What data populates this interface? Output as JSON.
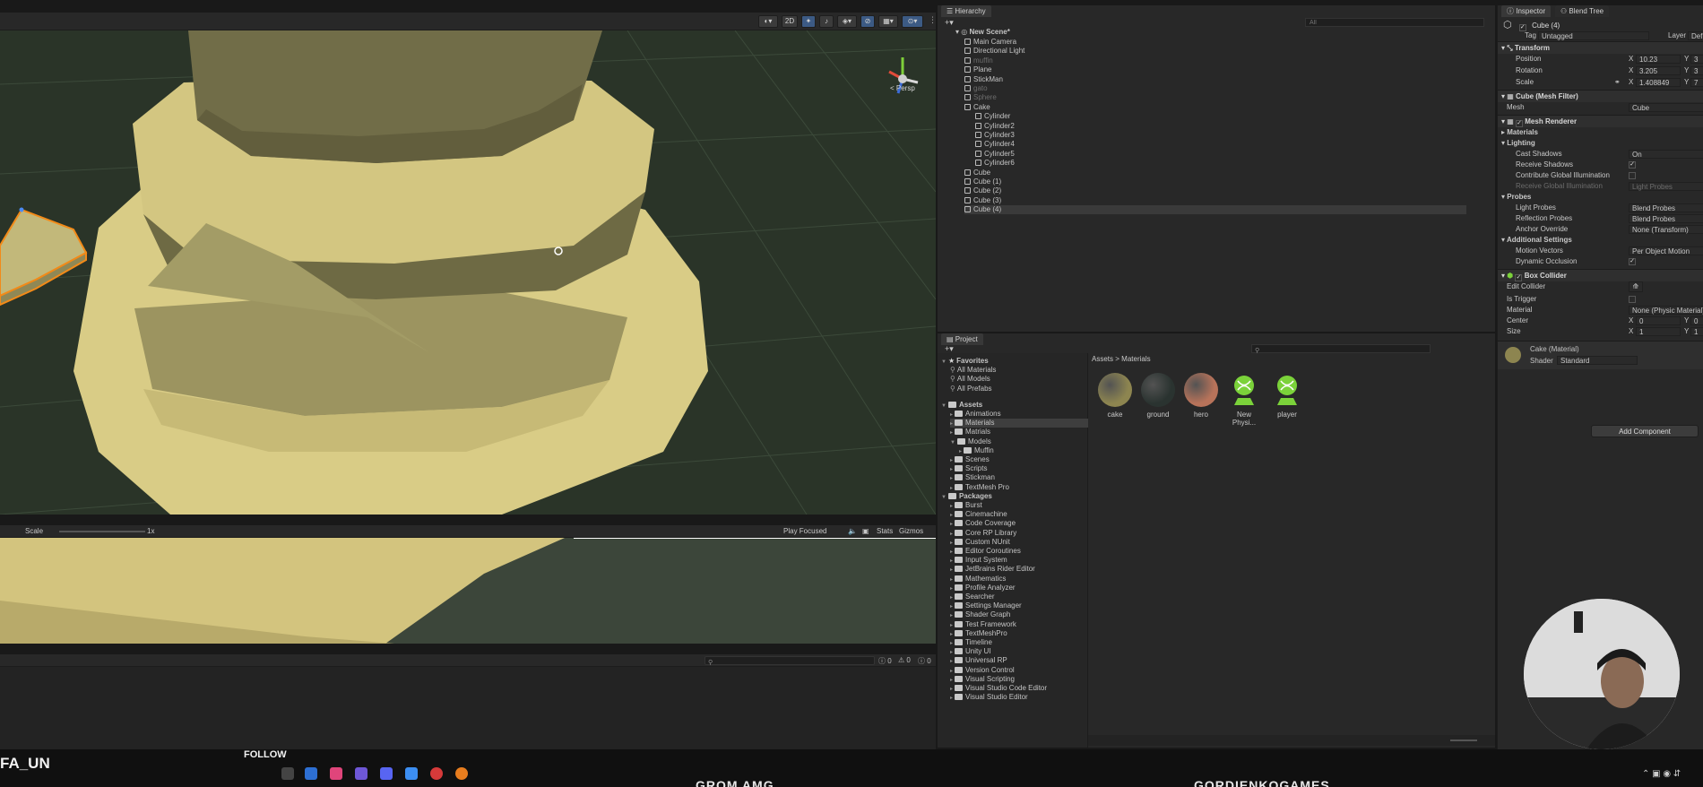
{
  "scene": {
    "toolbar": {
      "mode_2d": "2D",
      "persp_label": "< Persp"
    }
  },
  "game": {
    "scale_label": "Scale",
    "scale_value": "1x",
    "play_focused": "Play Focused",
    "stats": "Stats",
    "gizmos": "Gizmos"
  },
  "console": {
    "count_info": "0",
    "count_warn": "0",
    "count_error": "0"
  },
  "hierarchy": {
    "tab": "Hierarchy",
    "search_placeholder": "All",
    "scene_name": "New Scene*",
    "items": [
      {
        "label": "Main Camera",
        "indent": 1,
        "dim": false
      },
      {
        "label": "Directional Light",
        "indent": 1,
        "dim": false
      },
      {
        "label": "muffin",
        "indent": 1,
        "dim": true
      },
      {
        "label": "Plane",
        "indent": 1,
        "dim": false
      },
      {
        "label": "StickMan",
        "indent": 1,
        "dim": false
      },
      {
        "label": "gato",
        "indent": 1,
        "dim": true
      },
      {
        "label": "Sphere",
        "indent": 1,
        "dim": true
      },
      {
        "label": "Cake",
        "indent": 1,
        "dim": false
      },
      {
        "label": "Cylinder",
        "indent": 2,
        "dim": false
      },
      {
        "label": "Cylinder2",
        "indent": 2,
        "dim": false
      },
      {
        "label": "Cylinder3",
        "indent": 2,
        "dim": false
      },
      {
        "label": "Cylinder4",
        "indent": 2,
        "dim": false
      },
      {
        "label": "Cylinder5",
        "indent": 2,
        "dim": false
      },
      {
        "label": "Cylinder6",
        "indent": 2,
        "dim": false
      },
      {
        "label": "Cube",
        "indent": 1,
        "dim": false
      },
      {
        "label": "Cube (1)",
        "indent": 1,
        "dim": false
      },
      {
        "label": "Cube (2)",
        "indent": 1,
        "dim": false
      },
      {
        "label": "Cube (3)",
        "indent": 1,
        "dim": false
      },
      {
        "label": "Cube (4)",
        "indent": 1,
        "dim": false
      }
    ]
  },
  "project": {
    "tab": "Project",
    "breadcrumb_root": "Assets",
    "breadcrumb_sep": ">",
    "breadcrumb_current": "Materials",
    "favorites": {
      "header": "Favorites",
      "items": [
        "All Materials",
        "All Models",
        "All Prefabs"
      ]
    },
    "assets": {
      "header": "Assets",
      "items": [
        "Animations",
        "Materials",
        "Matrials",
        "Models",
        "Muffin",
        "Scenes",
        "Scripts",
        "Stickman",
        "TextMesh Pro"
      ]
    },
    "packages": {
      "header": "Packages",
      "items": [
        "Burst",
        "Cinemachine",
        "Code Coverage",
        "Core RP Library",
        "Custom NUnit",
        "Editor Coroutines",
        "Input System",
        "JetBrains Rider Editor",
        "Mathematics",
        "Profile Analyzer",
        "Searcher",
        "Settings Manager",
        "Shader Graph",
        "Test Framework",
        "TextMeshPro",
        "Timeline",
        "Unity UI",
        "Universal RP",
        "Version Control",
        "Visual Scripting",
        "Visual Studio Code Editor",
        "Visual Studio Editor"
      ]
    },
    "materials": [
      {
        "name": "cake",
        "color": "#8d8550"
      },
      {
        "name": "ground",
        "color": "#2a3330"
      },
      {
        "name": "hero",
        "color": "#b8735a"
      },
      {
        "name": "New Physi...",
        "color": "#7bd23a"
      },
      {
        "name": "player",
        "color": "#7bd23a"
      }
    ]
  },
  "inspector": {
    "tab": "Inspector",
    "tab2": "Blend Tree",
    "object_name": "Cube (4)",
    "tag_label": "Tag",
    "tag_value": "Untagged",
    "layer_label": "Layer",
    "layer_value": "Def",
    "transform": {
      "header": "Transform",
      "position_label": "Position",
      "position_x": "10.23",
      "position_y": "3",
      "rotation_label": "Rotation",
      "rotation_x": "3.205",
      "rotation_y": "3",
      "scale_label": "Scale",
      "scale_x": "1.408849",
      "scale_y": "7"
    },
    "mesh_filter": {
      "header": "Cube (Mesh Filter)",
      "mesh_label": "Mesh",
      "mesh_value": "Cube"
    },
    "mesh_renderer": {
      "header": "Mesh Renderer",
      "materials": "Materials",
      "lighting": "Lighting",
      "cast_shadows_label": "Cast Shadows",
      "cast_shadows_value": "On",
      "receive_shadows_label": "Receive Shadows",
      "contribute_gi_label": "Contribute Global Illumination",
      "receive_gi_label": "Receive Global Illumination",
      "receive_gi_value": "Light Probes",
      "probes": "Probes",
      "light_probes_label": "Light Probes",
      "light_probes_value": "Blend Probes",
      "reflection_probes_label": "Reflection Probes",
      "reflection_probes_value": "Blend Probes",
      "anchor_override_label": "Anchor Override",
      "anchor_override_value": "None (Transform)",
      "additional": "Additional Settings",
      "motion_vectors_label": "Motion Vectors",
      "motion_vectors_value": "Per Object Motion",
      "dynamic_occlusion_label": "Dynamic Occlusion"
    },
    "box_collider": {
      "header": "Box Collider",
      "edit_collider": "Edit Collider",
      "is_trigger": "Is Trigger",
      "material_label": "Material",
      "material_value": "None (Physic Material)",
      "center_label": "Center",
      "center_x": "0",
      "center_y": "0",
      "size_label": "Size",
      "size_x": "1",
      "size_y": "1"
    },
    "material": {
      "name": "Cake (Material)",
      "shader_label": "Shader",
      "shader_value": "Standard"
    },
    "add_component": "Add Component"
  },
  "taskbar": {
    "left_text": "FA_UN",
    "follow": "FOLLOW",
    "center_text": "GROM AMG",
    "right_text": "GORDIENKOGAMES"
  }
}
